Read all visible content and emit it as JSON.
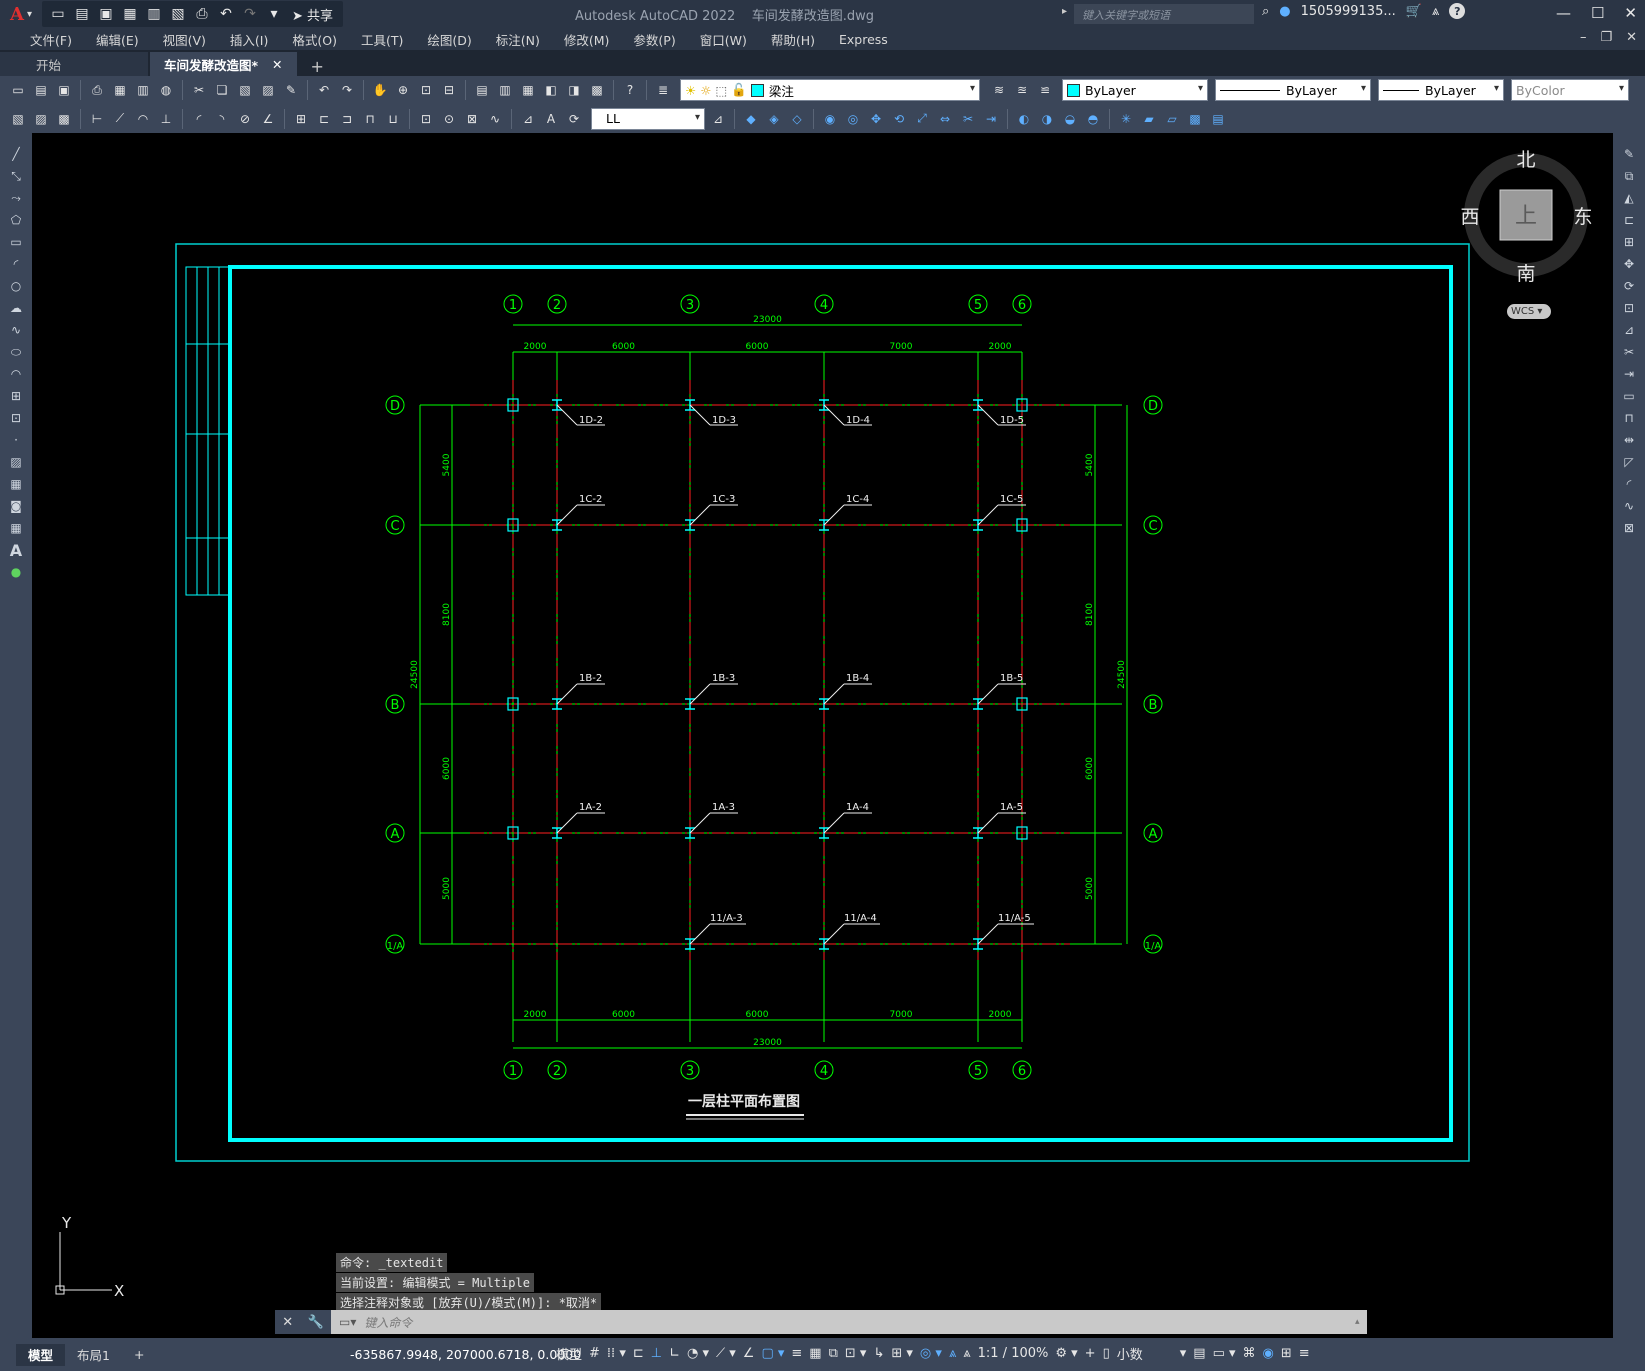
{
  "app": {
    "title": "Autodesk AutoCAD 2022    车间发酵改造图.dwg",
    "logo": "A",
    "share_label": "共享",
    "search_placeholder": "键入关键字或短语",
    "user": "1505999135...",
    "help": "?"
  },
  "menu": [
    "文件(F)",
    "编辑(E)",
    "视图(V)",
    "插入(I)",
    "格式(O)",
    "工具(T)",
    "绘图(D)",
    "标注(N)",
    "修改(M)",
    "参数(P)",
    "窗口(W)",
    "帮助(H)",
    "Express"
  ],
  "tabs": [
    {
      "label": "开始"
    },
    {
      "label": "车间发酵改造图*"
    }
  ],
  "layer_combo": "梁注",
  "color_combo": "ByLayer",
  "linetype_combo": "ByLayer",
  "lineweight_combo": "ByLayer",
  "plotstyle_combo": "ByColor",
  "dimstyle_combo": "LL",
  "viewcube": {
    "north": "北",
    "south": "南",
    "east": "东",
    "west": "西",
    "top": "上",
    "wcs": "WCS"
  },
  "drawing": {
    "title": "一层柱平面布置图",
    "grid_numbers": [
      "1",
      "2",
      "3",
      "4",
      "5",
      "6"
    ],
    "grid_letters": [
      "D",
      "C",
      "B",
      "A",
      "1/A"
    ],
    "top_total": "23000",
    "bottom_total": "23000",
    "spans": [
      "2000",
      "6000",
      "6000",
      "7000",
      "2000"
    ],
    "vspans": [
      "5400",
      "8100",
      "6000",
      "5000"
    ],
    "vtotal": "24500",
    "col_labels": {
      "D": [
        "1D-2",
        "1D-3",
        "1D-4",
        "1D-5"
      ],
      "C": [
        "1C-2",
        "1C-3",
        "1C-4",
        "1C-5"
      ],
      "B": [
        "1B-2",
        "1B-3",
        "1B-4",
        "1B-5"
      ],
      "A": [
        "1A-2",
        "1A-3",
        "1A-4",
        "1A-5"
      ],
      "1/A": [
        "11/A-3",
        "11/A-4",
        "11/A-5"
      ]
    }
  },
  "ucs": {
    "x": "X",
    "y": "Y"
  },
  "command": {
    "history": [
      "命令: _textedit",
      "当前设置: 编辑模式 = Multiple",
      "选择注释对象或 [放弃(U)/模式(M)]: *取消*"
    ],
    "placeholder": "键入命令"
  },
  "status": {
    "layouts": [
      "模型",
      "布局1"
    ],
    "coords": "-635867.9948, 207000.6718, 0.0000",
    "model": "模型",
    "scale": "1:1 / 100%",
    "units": "小数"
  }
}
